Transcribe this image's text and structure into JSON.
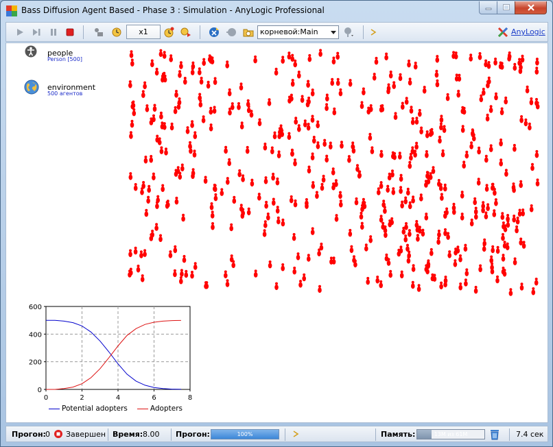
{
  "window": {
    "title": "Bass Diffusion Agent Based - Phase 3 : Simulation - AnyLogic Professional"
  },
  "toolbar": {
    "speed": "x1",
    "root_select": "корневой:Main",
    "brand_link": "AnyLogic"
  },
  "objects": [
    {
      "name": "people",
      "subtitle": "Person [500]",
      "icon": "person-icon"
    },
    {
      "name": "environment",
      "subtitle": "500 агентов",
      "icon": "globe-icon"
    }
  ],
  "colors": {
    "agent": "#ff0000",
    "potential": "#0000cc",
    "adopters": "#dd1111",
    "accent": "#3c87d8"
  },
  "chart_data": {
    "type": "line",
    "x": [
      0,
      0.5,
      1,
      1.5,
      2,
      2.5,
      3,
      3.5,
      4,
      4.5,
      5,
      5.5,
      6,
      6.5,
      7,
      7.5
    ],
    "series": [
      {
        "name": "Potential adopters",
        "values": [
          500,
          500,
          494,
          483,
          459,
          415,
          350,
          270,
          185,
          110,
          60,
          30,
          14,
          6,
          2,
          1
        ]
      },
      {
        "name": "Adopters",
        "values": [
          0,
          0,
          6,
          17,
          41,
          85,
          150,
          230,
          315,
          390,
          440,
          470,
          486,
          494,
          498,
          499
        ]
      }
    ],
    "xlim": [
      0,
      8
    ],
    "ylim": [
      0,
      600
    ],
    "xticks": [
      "0",
      "2",
      "4",
      "6",
      "8"
    ],
    "yticks": [
      "0",
      "200",
      "400",
      "600"
    ],
    "grid": true,
    "legend": "bottom"
  },
  "status": {
    "run_label": "Прогон:",
    "run_number": "0",
    "run_state": "Завершен",
    "time_label": "Время:",
    "time_value": "8.00",
    "progress_label": "Прогон:",
    "progress_text": "100%",
    "progress_fraction": 1.0,
    "memory_label": "Память:",
    "memory_text": "13M из 61M",
    "memory_fraction": 0.21,
    "elapsed": "7.4 сек"
  }
}
